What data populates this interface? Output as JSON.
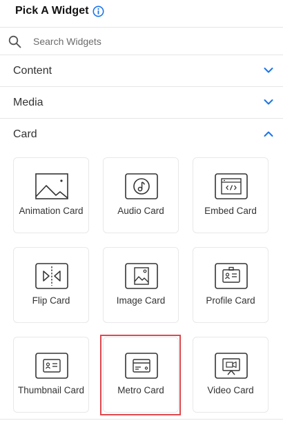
{
  "header": {
    "title": "Pick A Widget",
    "info_icon": "info-circle-icon",
    "accent": "#1a73e8"
  },
  "search": {
    "placeholder": "Search Widgets",
    "value": ""
  },
  "sections": [
    {
      "label": "Content",
      "expanded": false
    },
    {
      "label": "Media",
      "expanded": false
    },
    {
      "label": "Card",
      "expanded": true
    }
  ],
  "cards": [
    {
      "label": "Animation Card",
      "icon": "landscape-image-icon",
      "selected": false
    },
    {
      "label": "Audio Card",
      "icon": "music-note-icon",
      "selected": false
    },
    {
      "label": "Embed Card",
      "icon": "code-window-icon",
      "selected": false
    },
    {
      "label": "Flip Card",
      "icon": "flip-icon",
      "selected": false
    },
    {
      "label": "Image Card",
      "icon": "image-icon",
      "selected": false
    },
    {
      "label": "Profile Card",
      "icon": "id-badge-icon",
      "selected": false
    },
    {
      "label": "Thumbnail Card",
      "icon": "contact-card-icon",
      "selected": false
    },
    {
      "label": "Metro Card",
      "icon": "credit-card-icon",
      "selected": true
    },
    {
      "label": "Video Card",
      "icon": "video-presentation-icon",
      "selected": false
    }
  ],
  "colors": {
    "selection": "#e0474c",
    "chevron": "#1a73e8",
    "icon_stroke": "#333333"
  }
}
